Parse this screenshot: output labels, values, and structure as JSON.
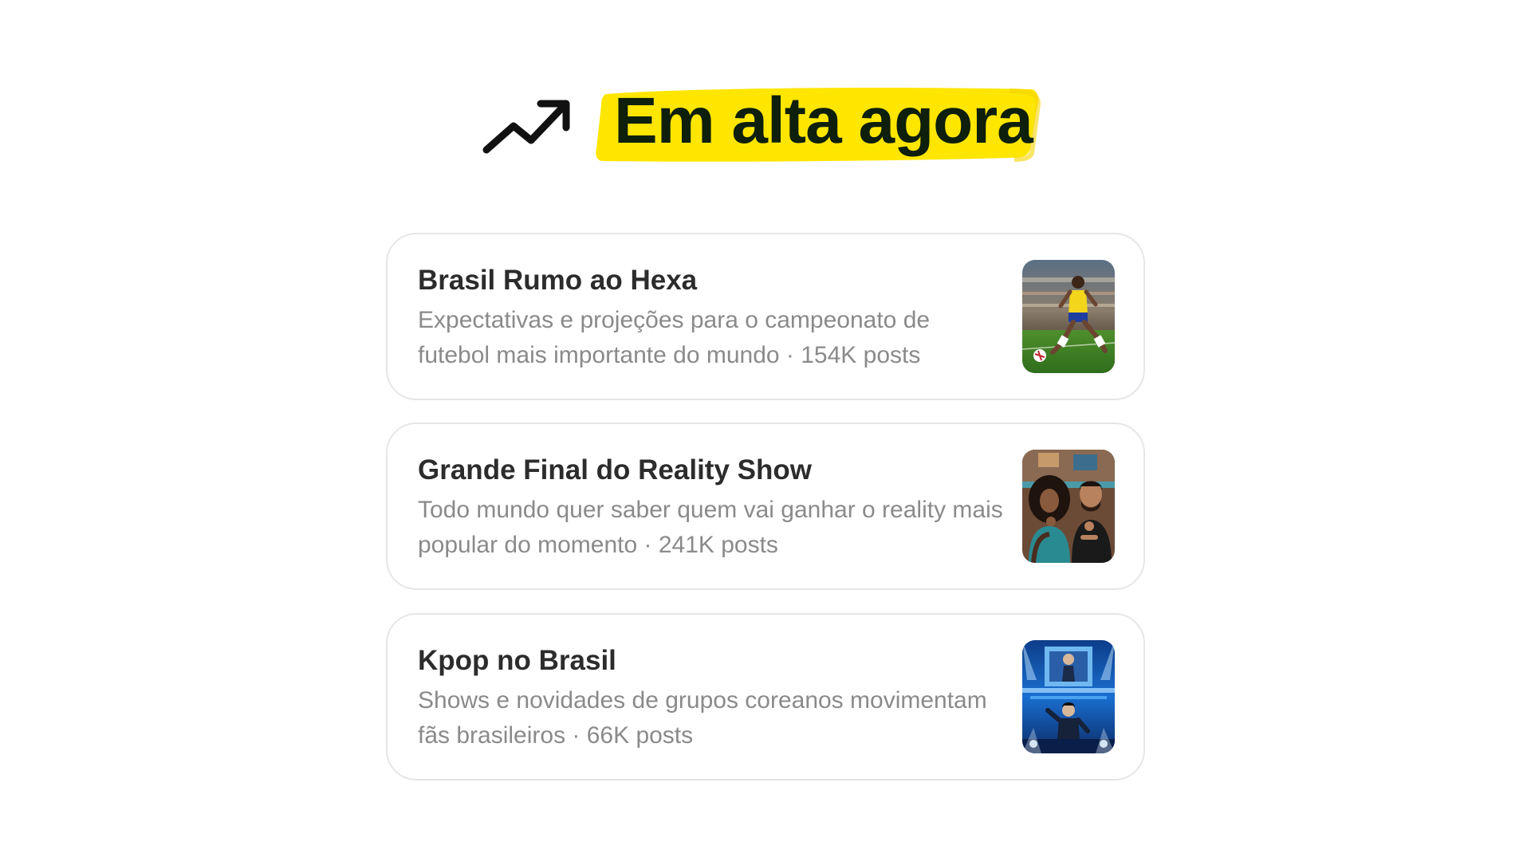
{
  "header": {
    "title": "Em alta agora",
    "icon": "trending-up-icon",
    "highlight_color": "#ffe600"
  },
  "trends": [
    {
      "title": "Brasil Rumo ao Hexa",
      "description": "Expectativas e projeções para o campeonato de futebol mais importante do mundo · 154K posts",
      "image": "soccer-player-image"
    },
    {
      "title": "Grande Final do Reality Show",
      "description": "Todo mundo quer saber quem vai ganhar o reality mais popular do momento · 241K posts",
      "image": "reality-show-viewers-image"
    },
    {
      "title": "Kpop no Brasil",
      "description": "Shows e novidades de grupos coreanos movimentam fãs brasileiros · 66K posts",
      "image": "kpop-concert-image"
    }
  ]
}
